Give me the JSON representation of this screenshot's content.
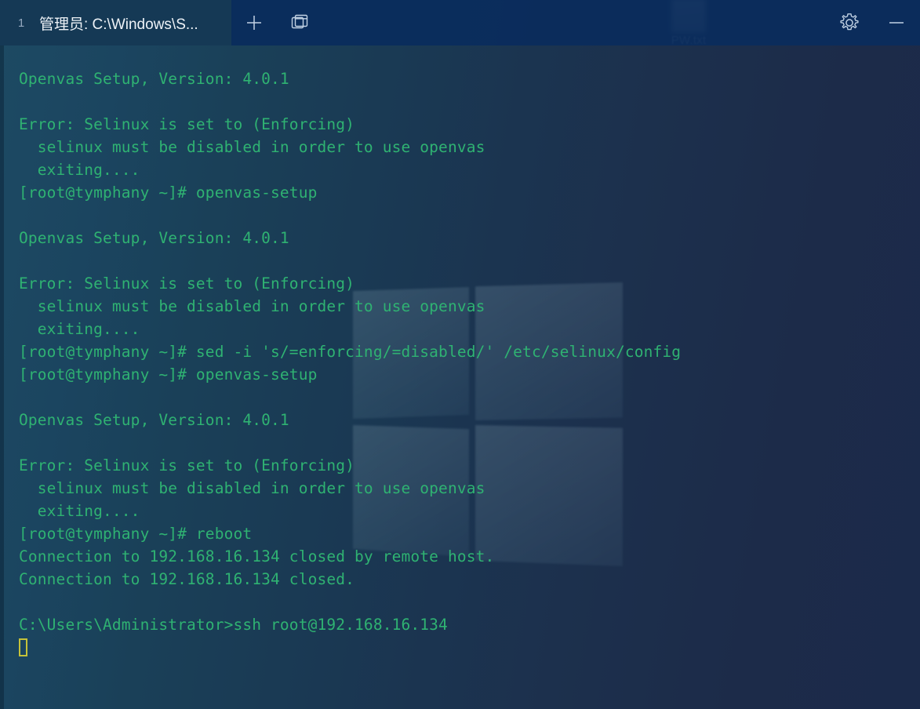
{
  "window": {
    "app": "windows-terminal",
    "bg_left_color": "#1d4a63",
    "bg_right_color": "#1b2a4a",
    "titlebar_color": "#0a2c5c",
    "accent_green": "#2fb272",
    "cursor_color": "#c5c23a"
  },
  "titlebar": {
    "tab": {
      "number": "1",
      "title": "管理员: C:\\Windows\\S..."
    },
    "new_tab_label": "+",
    "icons": {
      "new_tab": "plus-icon",
      "tab_dropdown": "panes-dropdown-icon",
      "settings": "gear-icon",
      "minimize": "minimize-icon"
    }
  },
  "desktop": {
    "icon_label": "PW.txt",
    "icon_name": "text-file-icon"
  },
  "terminal": {
    "lines": [
      "Openvas Setup, Version: 4.0.1",
      "",
      "Error: Selinux is set to (Enforcing)",
      "  selinux must be disabled in order to use openvas",
      "  exiting....",
      "[root@tymphany ~]# openvas-setup",
      "",
      "Openvas Setup, Version: 4.0.1",
      "",
      "Error: Selinux is set to (Enforcing)",
      "  selinux must be disabled in order to use openvas",
      "  exiting....",
      "[root@tymphany ~]# sed -i 's/=enforcing/=disabled/' /etc/selinux/config",
      "[root@tymphany ~]# openvas-setup",
      "",
      "Openvas Setup, Version: 4.0.1",
      "",
      "Error: Selinux is set to (Enforcing)",
      "  selinux must be disabled in order to use openvas",
      "  exiting....",
      "[root@tymphany ~]# reboot",
      "Connection to 192.168.16.134 closed by remote host.",
      "Connection to 192.168.16.134 closed.",
      "",
      "C:\\Users\\Administrator>ssh root@192.168.16.134"
    ],
    "prompt_cursor": "block-cursor"
  }
}
